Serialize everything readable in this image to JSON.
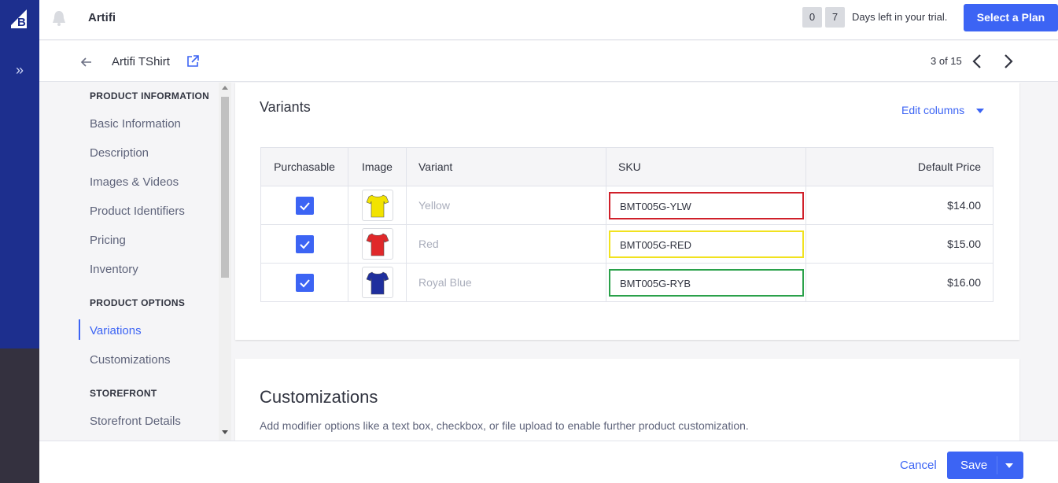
{
  "app": {
    "store_name": "Artifi"
  },
  "trial": {
    "digit1": "0",
    "digit2": "7",
    "text": "Days left in your trial.",
    "plan_button": "Select a Plan"
  },
  "product": {
    "title": "Artifi TShirt",
    "pager": "3 of 15"
  },
  "sidebar": {
    "sections": [
      {
        "label": "PRODUCT INFORMATION",
        "items": [
          "Basic Information",
          "Description",
          "Images & Videos",
          "Product Identifiers",
          "Pricing",
          "Inventory"
        ]
      },
      {
        "label": "PRODUCT OPTIONS",
        "items": [
          "Variations",
          "Customizations"
        ]
      },
      {
        "label": "STOREFRONT",
        "items": [
          "Storefront Details"
        ]
      }
    ],
    "active_item": "Variations"
  },
  "variants": {
    "title": "Variants",
    "edit_columns": "Edit columns",
    "headers": [
      "Purchasable",
      "Image",
      "Variant",
      "SKU",
      "Default Price"
    ],
    "rows": [
      {
        "variant": "Yellow",
        "sku": "BMT005G-YLW",
        "price": "$14.00",
        "shirt_color": "#f2e300",
        "highlight": "#d0202a"
      },
      {
        "variant": "Red",
        "sku": "BMT005G-RED",
        "price": "$15.00",
        "shirt_color": "#e0282a",
        "highlight": "#f1e21f"
      },
      {
        "variant": "Royal Blue",
        "sku": "BMT005G-RYB",
        "price": "$16.00",
        "shirt_color": "#1f2f9e",
        "highlight": "#2aa14a"
      }
    ]
  },
  "customizations": {
    "title": "Customizations",
    "description": "Add modifier options like a text box, checkbox, or file upload to enable further product customization."
  },
  "footer": {
    "cancel": "Cancel",
    "save": "Save"
  },
  "colors": {
    "accent": "#3c64f4",
    "rail": "#1d2f8e",
    "rail_dark": "#34313f"
  },
  "icons": [
    "bigcommerce-logo-icon",
    "expand-chevrons-icon",
    "bell-icon",
    "back-arrow-icon",
    "external-link-icon",
    "chevron-left-icon",
    "chevron-right-icon",
    "checkmark-icon",
    "caret-down-icon"
  ]
}
